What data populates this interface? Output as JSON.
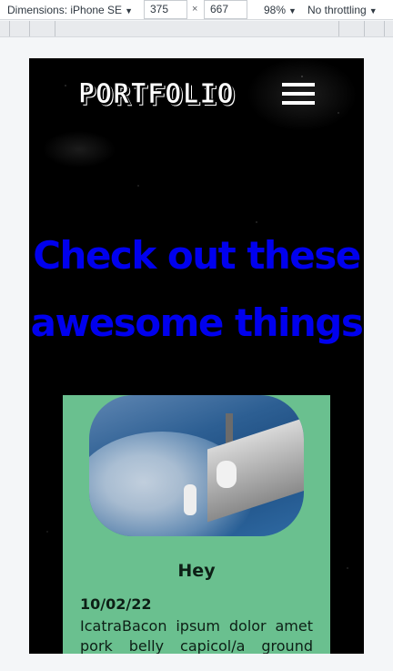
{
  "devtools": {
    "dimensions_label": "Dimensions: iPhone SE",
    "width": "375",
    "height": "667",
    "zoom": "98%",
    "throttling": "No throttling"
  },
  "site": {
    "logo": "PORTFOLIO",
    "hero_text": "Check out these awesome things",
    "card": {
      "title": "Hey",
      "date": "10/02/22",
      "body": "IcatraBacon ipsum dolor amet pork belly capicol/a ground round"
    }
  },
  "colors": {
    "hero": "#0000ee",
    "card_bg": "#6ac08f",
    "page_bg": "#000000"
  }
}
